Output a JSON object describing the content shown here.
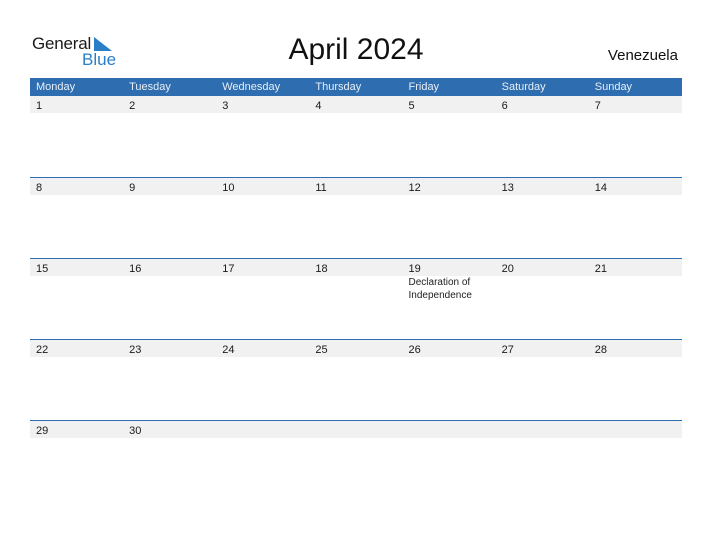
{
  "logo": {
    "line1": "General",
    "line2": "Blue",
    "icon": "triangle-flag-icon"
  },
  "header": {
    "title": "April 2024",
    "country": "Venezuela"
  },
  "colors": {
    "accent": "#2e6eb0",
    "strip": "#f1f1f1",
    "logo_blue": "#2a7fc9"
  },
  "weekdays": [
    "Monday",
    "Tuesday",
    "Wednesday",
    "Thursday",
    "Friday",
    "Saturday",
    "Sunday"
  ],
  "weeks": [
    {
      "days": [
        {
          "num": "1"
        },
        {
          "num": "2"
        },
        {
          "num": "3"
        },
        {
          "num": "4"
        },
        {
          "num": "5"
        },
        {
          "num": "6"
        },
        {
          "num": "7"
        }
      ]
    },
    {
      "days": [
        {
          "num": "8"
        },
        {
          "num": "9"
        },
        {
          "num": "10"
        },
        {
          "num": "11"
        },
        {
          "num": "12"
        },
        {
          "num": "13"
        },
        {
          "num": "14"
        }
      ]
    },
    {
      "days": [
        {
          "num": "15"
        },
        {
          "num": "16"
        },
        {
          "num": "17"
        },
        {
          "num": "18"
        },
        {
          "num": "19",
          "event": "Declaration of Independence"
        },
        {
          "num": "20"
        },
        {
          "num": "21"
        }
      ]
    },
    {
      "days": [
        {
          "num": "22"
        },
        {
          "num": "23"
        },
        {
          "num": "24"
        },
        {
          "num": "25"
        },
        {
          "num": "26"
        },
        {
          "num": "27"
        },
        {
          "num": "28"
        }
      ]
    },
    {
      "days": [
        {
          "num": "29"
        },
        {
          "num": "30"
        },
        {
          "num": ""
        },
        {
          "num": ""
        },
        {
          "num": ""
        },
        {
          "num": ""
        },
        {
          "num": ""
        }
      ]
    }
  ]
}
